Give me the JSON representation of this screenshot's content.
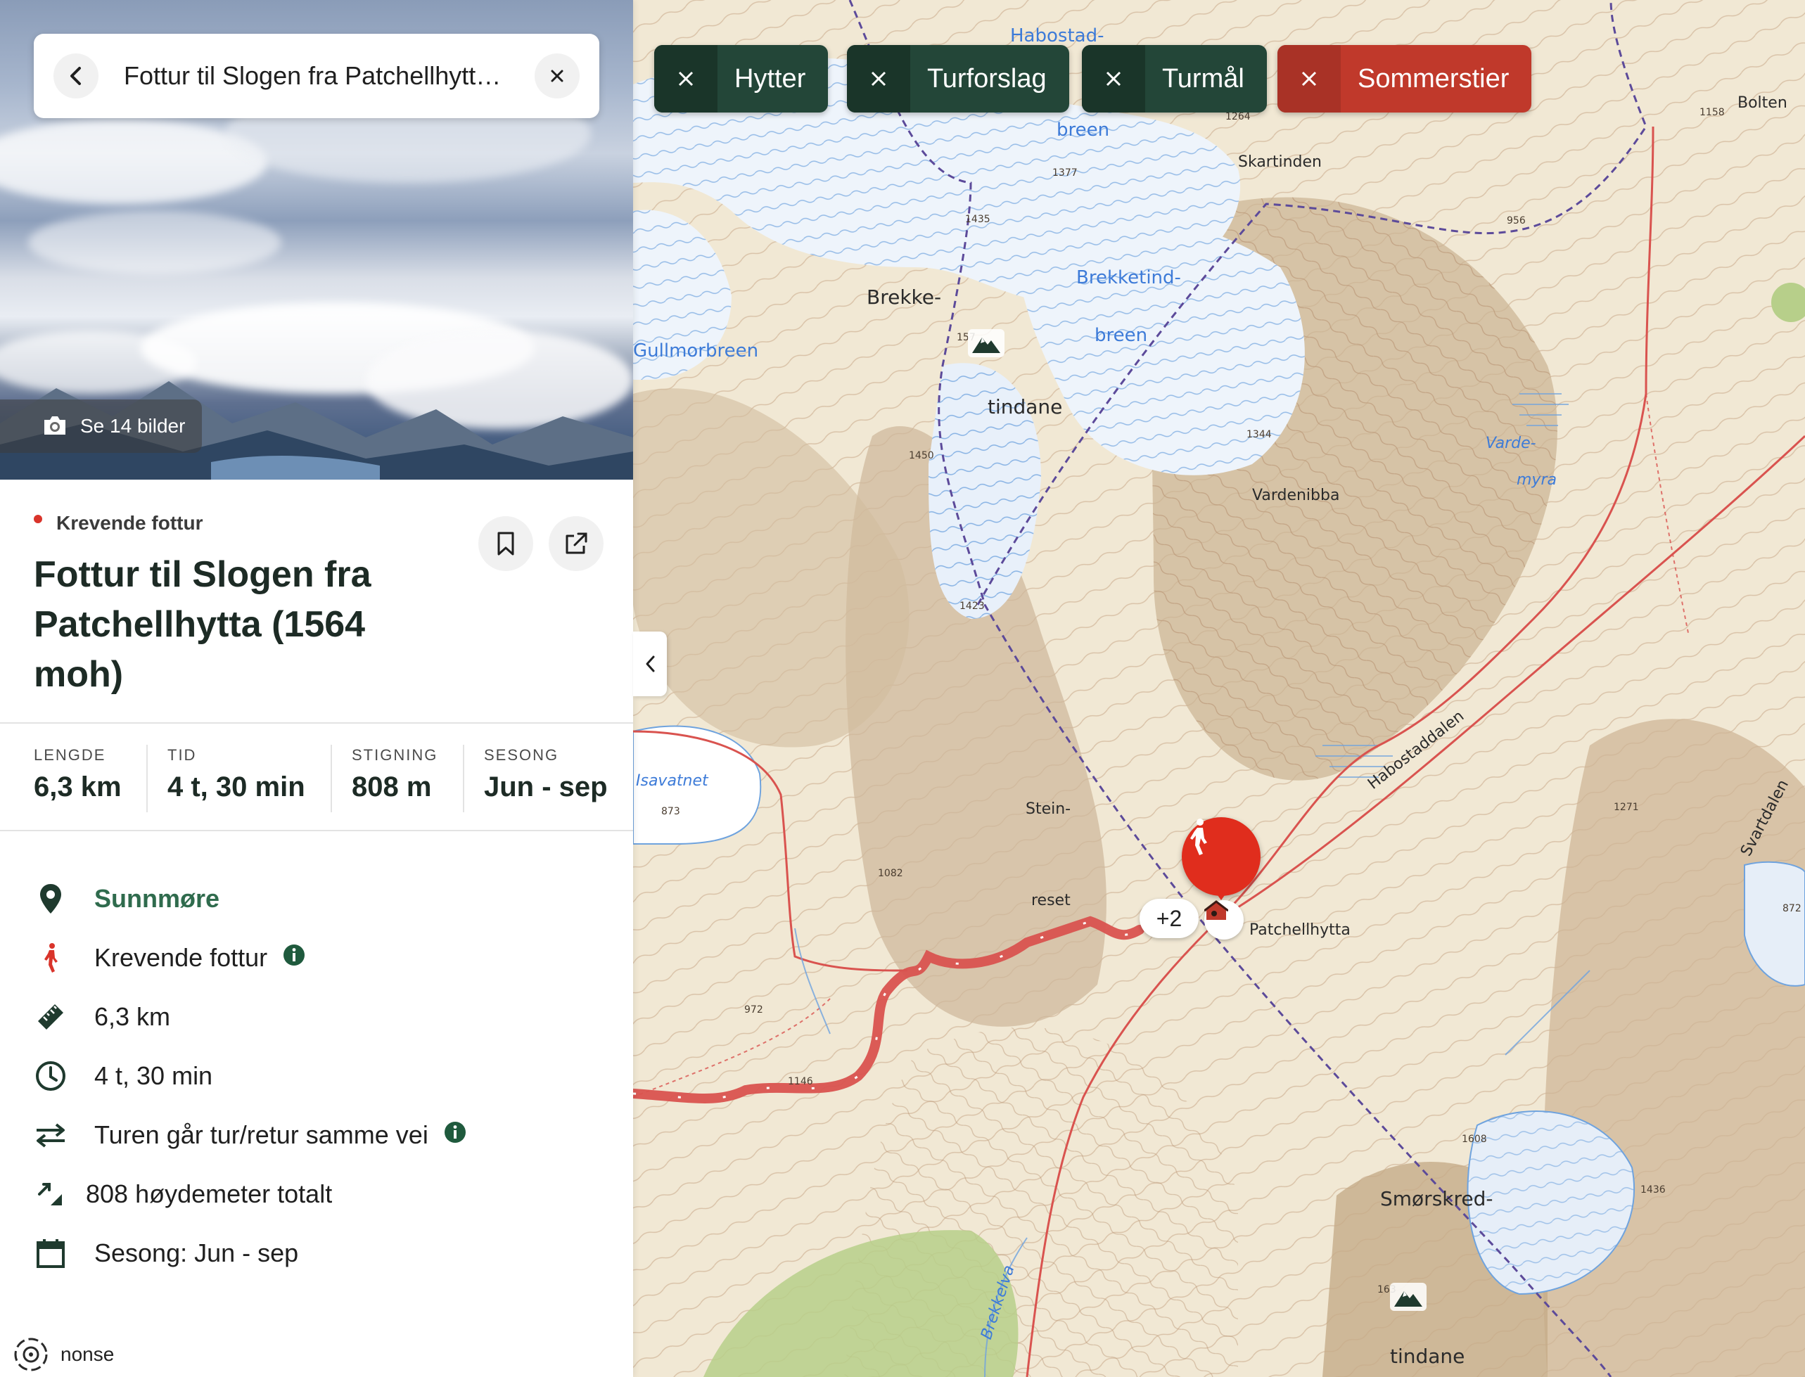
{
  "search": {
    "text": "Fottur til Slogen fra Patchellhytta (1564 moh)"
  },
  "hero": {
    "photo_button_label": "Se 14 bilder"
  },
  "trip": {
    "category": "Krevende fottur",
    "title": "Fottur til Slogen fra Patchellhytta (1564 moh)"
  },
  "stats": [
    {
      "label": "LENGDE",
      "value": "6,3 km"
    },
    {
      "label": "TID",
      "value": "4 t, 30 min"
    },
    {
      "label": "STIGNING",
      "value": "808 m"
    },
    {
      "label": "SESONG",
      "value": "Jun - sep"
    }
  ],
  "details": {
    "region": "Sunnmøre",
    "difficulty": "Krevende fottur",
    "distance": "6,3 km",
    "duration": "4 t, 30 min",
    "route_type": "Turen går tur/retur samme vei",
    "elevation": "808 høydemeter totalt",
    "season": "Sesong: Jun - sep"
  },
  "footer": {
    "brand_text": "nonse"
  },
  "filters": [
    {
      "label": "Hytter",
      "style": "green"
    },
    {
      "label": "Turforslag",
      "style": "green"
    },
    {
      "label": "Turmål",
      "style": "green"
    },
    {
      "label": "Sommerstier",
      "style": "red"
    }
  ],
  "map": {
    "cluster_count": "+2",
    "cabin_name": "Patchellhytta",
    "place_names": {
      "habostad": "Habostad-",
      "breen_top": "breen",
      "skartinden": "Skartinden",
      "bolten": "Bolten",
      "brekke": "Brekke-",
      "tindane_1": "tindane",
      "brekketind": "Brekketind-",
      "breen_mid": "breen",
      "gullmorbreen": "Gullmorbreen",
      "varde": "Varde-",
      "myra": "myra",
      "vardenibba": "Vardenibba",
      "isavatnet": "Isavatnet",
      "stein": "Stein-",
      "reset": "reset",
      "habostaddalen": "Habostaddalen",
      "svartdalen": "Svartdalen",
      "smorskred": "Smørskred-",
      "tindane_2": "tindane",
      "brekkelva": "Brekkelva"
    },
    "elevations": {
      "e1264": "1264",
      "e1158": "1158",
      "e1377": "1377",
      "e956": "956",
      "e1435": "1435",
      "e157": "157",
      "e1344": "1344",
      "e1450": "1450",
      "e1423": "1423",
      "e873": "873",
      "e1082": "1082",
      "e1271": "1271",
      "e872": "872",
      "e972": "972",
      "e1146": "1146",
      "e1608": "1608",
      "e1436": "1436",
      "e163": "163"
    }
  },
  "colors": {
    "brand_green": "#234638",
    "accent_red": "#c0392b",
    "route_red": "#d9534f",
    "pin_red": "#e02d1d",
    "region_green": "#2f6b4d"
  }
}
